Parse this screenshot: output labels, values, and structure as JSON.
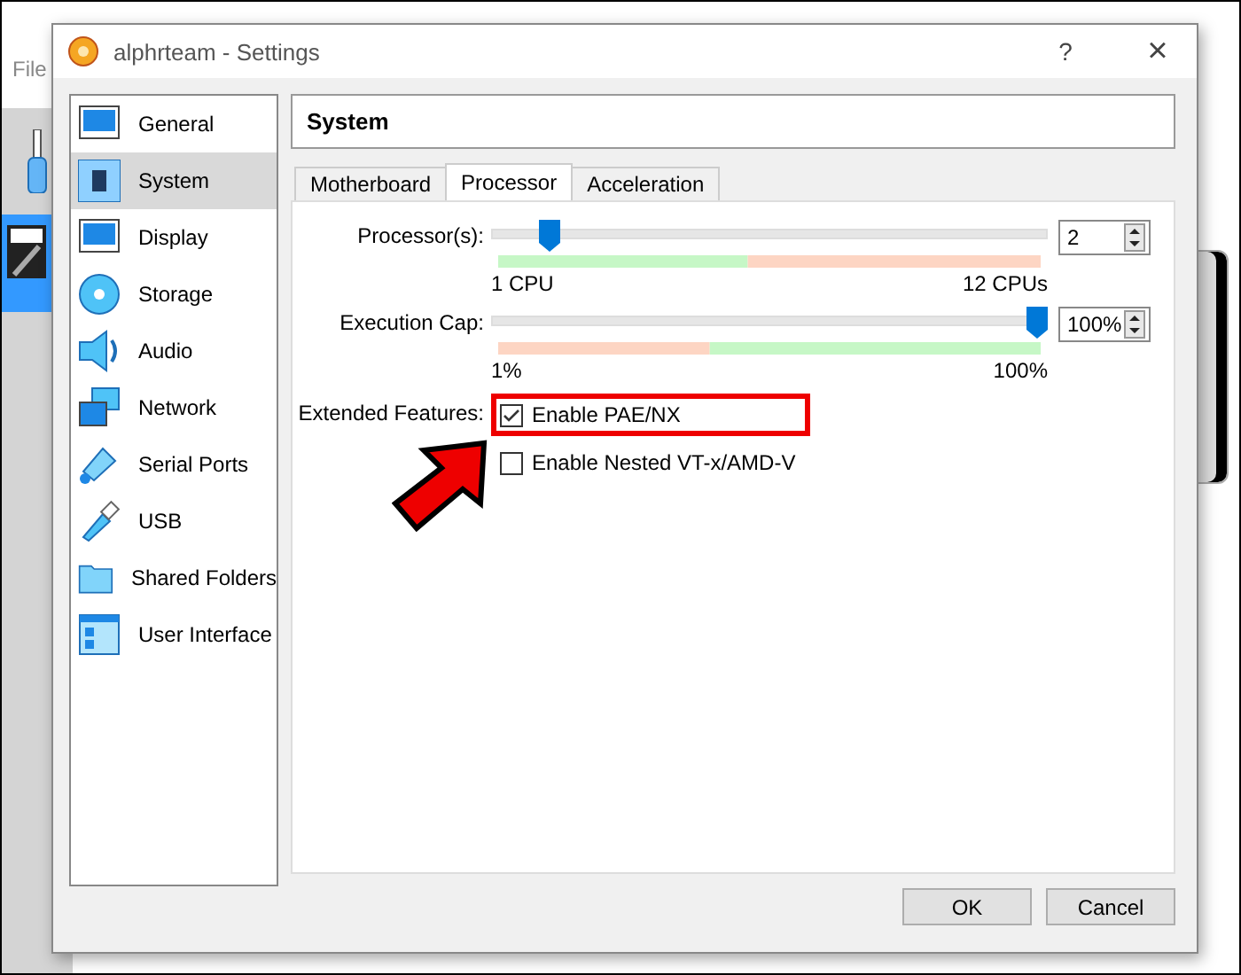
{
  "background_window": {
    "menu": [
      "File"
    ]
  },
  "dialog": {
    "title": "alphrteam - Settings",
    "help": "?",
    "close": "×"
  },
  "sidebar": {
    "items": [
      {
        "label": "General",
        "selected": false
      },
      {
        "label": "System",
        "selected": true
      },
      {
        "label": "Display",
        "selected": false
      },
      {
        "label": "Storage",
        "selected": false
      },
      {
        "label": "Audio",
        "selected": false
      },
      {
        "label": "Network",
        "selected": false
      },
      {
        "label": "Serial Ports",
        "selected": false
      },
      {
        "label": "USB",
        "selected": false
      },
      {
        "label": "Shared Folders",
        "selected": false
      },
      {
        "label": "User Interface",
        "selected": false
      }
    ]
  },
  "page_title": "System",
  "tabs": [
    {
      "label": "Motherboard",
      "selected": false
    },
    {
      "label": "Processor",
      "selected": true
    },
    {
      "label": "Acceleration",
      "selected": false
    }
  ],
  "sliders": [
    {
      "label": "Processor(s):",
      "level": 0.09,
      "value": "2",
      "min_label": "1 CPU",
      "max_label": "12 CPUs",
      "kind": "cpu"
    },
    {
      "label": "Execution Cap:",
      "level": 1,
      "value": "100%",
      "min_label": "1%",
      "max_label": "100%",
      "kind": "cap"
    }
  ],
  "features": {
    "label": "Extended Features:",
    "options": [
      {
        "label": "Enable PAE/NX",
        "checked": true,
        "highlighted": true
      },
      {
        "label": "Enable Nested VT-x/AMD-V",
        "checked": false,
        "highlighted": false
      }
    ]
  },
  "buttons": [
    "OK",
    "Cancel"
  ]
}
